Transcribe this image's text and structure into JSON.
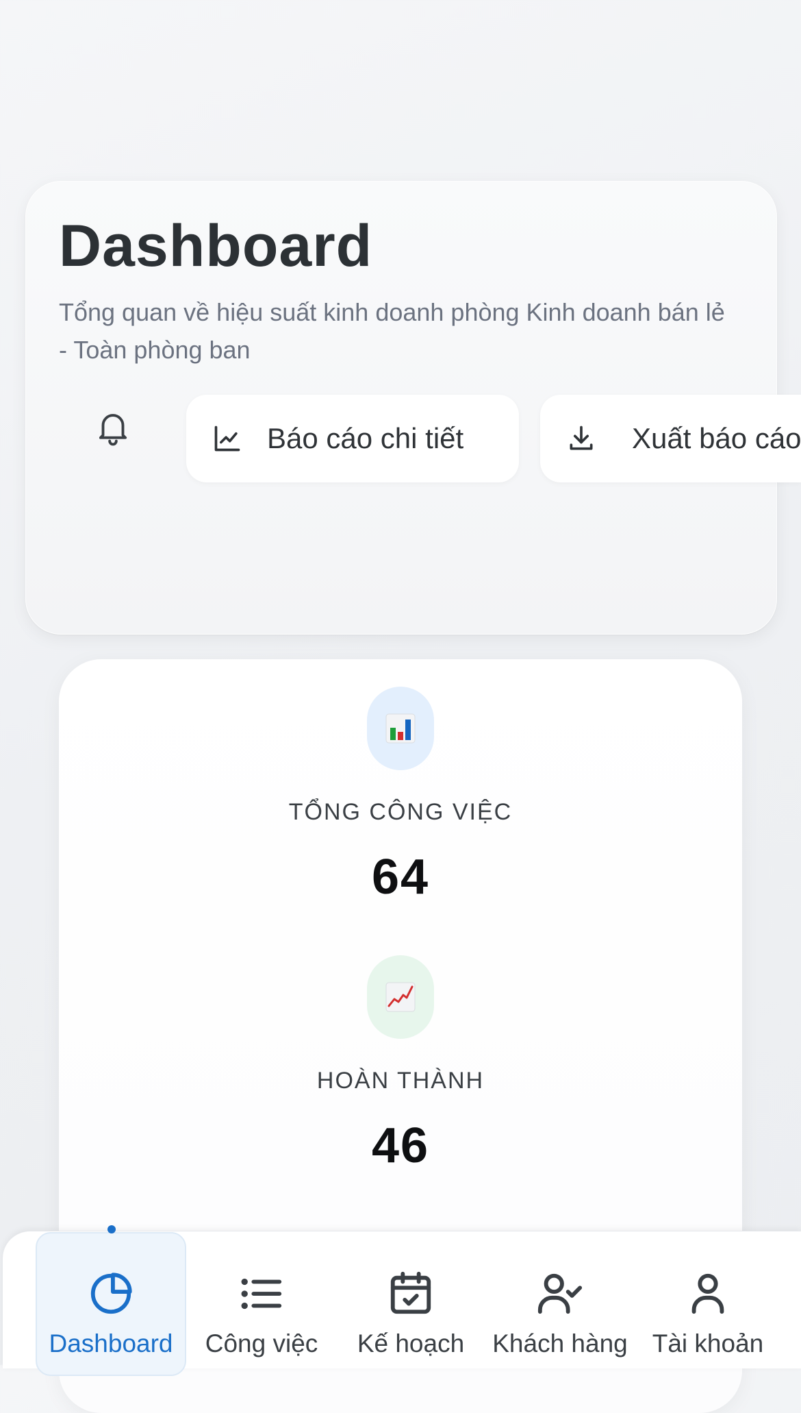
{
  "header": {
    "title": "Dashboard",
    "subtitle": "Tổng quan về hiệu suất kinh doanh phòng Kinh doanh bán lẻ - Toàn phòng ban",
    "actions": {
      "notifications_icon": "bell-icon",
      "report_label": "Báo cáo chi tiết",
      "report_icon": "line-chart-icon",
      "export_label": "Xuất báo cáo",
      "export_icon": "download-icon"
    }
  },
  "stats": [
    {
      "icon": "bar-chart-emoji",
      "label": "TỔNG CÔNG VIỆC",
      "value": "64",
      "icon_bg": "#e3effd"
    },
    {
      "icon": "chart-increasing-emoji",
      "label": "HOÀN THÀNH",
      "value": "46",
      "icon_bg": "#e7f6ec"
    }
  ],
  "bottom_nav": {
    "active": "Dashboard",
    "items": [
      {
        "label": "Dashboard",
        "icon": "pie-chart-icon"
      },
      {
        "label": "Công việc",
        "icon": "list-icon"
      },
      {
        "label": "Kế hoạch",
        "icon": "calendar-check-icon"
      },
      {
        "label": "Khách hàng",
        "icon": "user-check-icon"
      },
      {
        "label": "Tài khoản",
        "icon": "user-icon"
      }
    ]
  },
  "colors": {
    "accent": "#1a6fc9",
    "title": "#2c3135",
    "muted_text": "#6b7280"
  }
}
